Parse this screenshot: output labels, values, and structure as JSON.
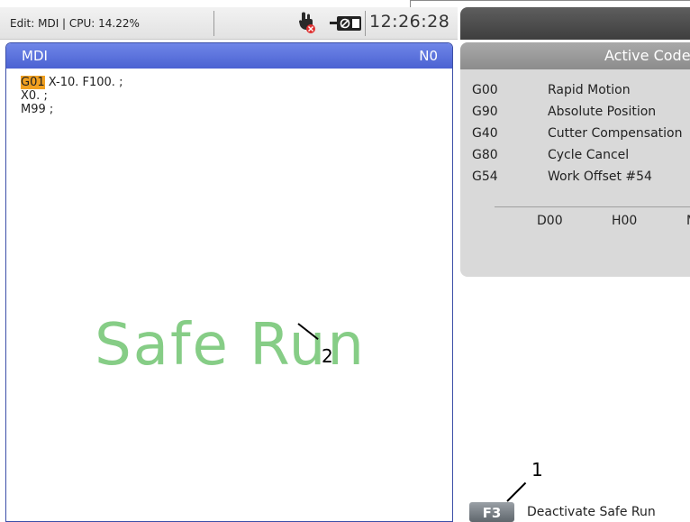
{
  "status_bar": {
    "text": "Edit: MDI | CPU: 14.22%",
    "time": "12:26:28",
    "icons": [
      "program-lock-disabled-icon",
      "memory-lock-icon"
    ]
  },
  "mdi": {
    "title": "MDI",
    "n_number": "N0",
    "code_lines": [
      {
        "highlight": "G01",
        "rest": " X-10. F100. ;"
      },
      {
        "highlight": "",
        "rest": "X0. ;"
      },
      {
        "highlight": "",
        "rest": "M99 ;"
      }
    ],
    "safe_run_text": "Safe Run"
  },
  "active_codes": {
    "title": "Active Codes",
    "rows": [
      {
        "code": "G00",
        "desc": "Rapid Motion"
      },
      {
        "code": "G90",
        "desc": "Absolute Position"
      },
      {
        "code": "G40",
        "desc": "Cutter Compensation"
      },
      {
        "code": "G80",
        "desc": "Cycle Cancel"
      },
      {
        "code": "G54",
        "desc": "Work Offset #54"
      }
    ],
    "offsets": [
      "D00",
      "H00",
      "M"
    ]
  },
  "function_key": {
    "key": "F3",
    "label": "Deactivate Safe Run"
  },
  "callouts": [
    "1",
    "2"
  ],
  "colors": {
    "mdi_header": "#5a70dc",
    "safe_run": "#86cd86",
    "highlight": "#f0a020"
  }
}
